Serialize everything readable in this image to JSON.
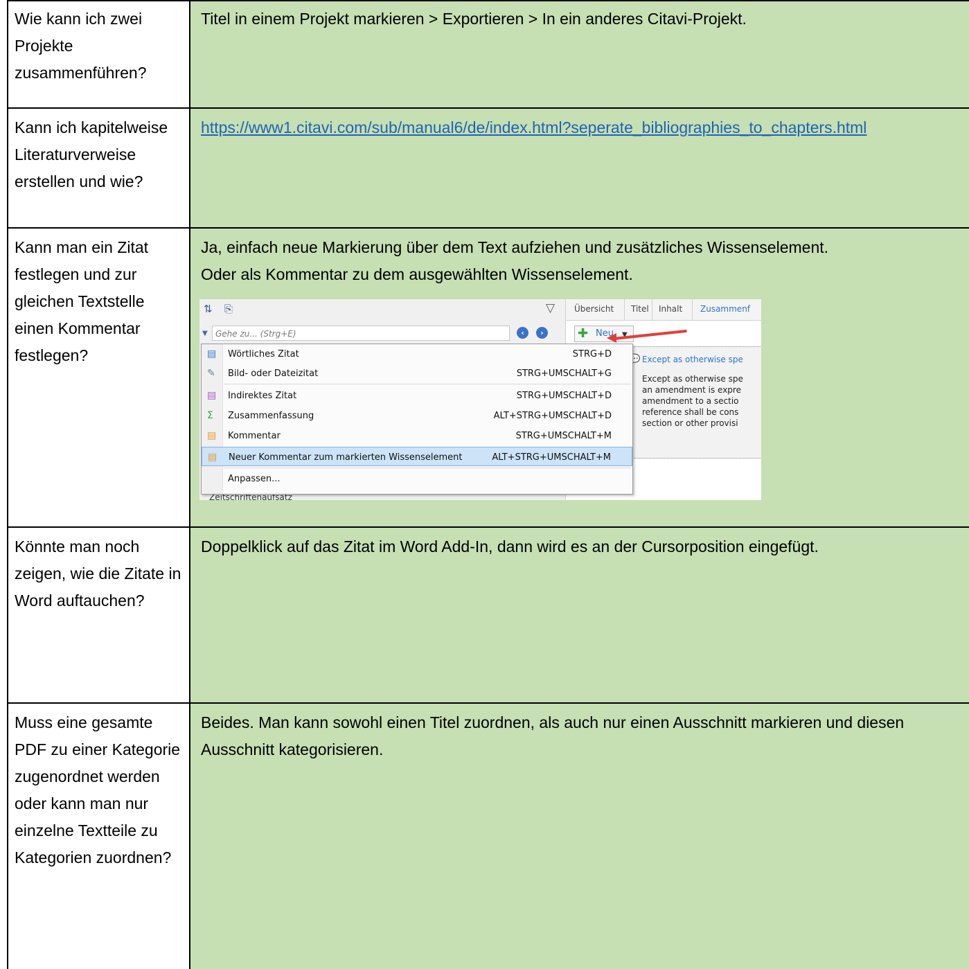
{
  "rows": [
    {
      "question": "Wie kann ich zwei Projekte zusammenführen?",
      "answer": "Titel in einem Projekt markieren > Exportieren > In ein anderes Citavi-Projekt."
    },
    {
      "question": "Kann ich kapitelweise Literaturverweise erstellen und wie?",
      "answer_link": "https://www1.citavi.com/sub/manual6/de/index.html?seperate_bibliographies_to_chapters.html"
    },
    {
      "question": "Kann man ein Zitat festlegen und zur gleichen Textstelle einen Kommentar festlegen?",
      "answer_line1": "Ja, einfach neue Markierung über dem Text aufziehen und zusätzliches Wissenselement.",
      "answer_line2": "Oder als Kommentar zu dem ausgewählten Wissenselement."
    },
    {
      "question": "Könnte man noch zeigen, wie die Zitate in Word auftauchen?",
      "answer": "Doppelklick auf das Zitat im Word Add-In, dann wird es an der Cursorposition eingefügt."
    },
    {
      "question": "Muss eine gesamte PDF zu einer Kategorie zugenordnet werden oder kann man nur einzelne Textteile zu Kategorien zuordnen?",
      "answer": "Beides. Man kann sowohl einen Titel zuordnen, als auch nur einen Ausschnitt markieren und diesen Ausschnitt kategorisieren."
    }
  ],
  "screenshot": {
    "search_placeholder": "Gehe zu... (Strg+E)",
    "tabs": [
      "Übersicht",
      "Titel",
      "Inhalt",
      "Zusammenf"
    ],
    "new_button": "Neu",
    "knowledge_title": "Except as otherwise spe",
    "knowledge_text": "Except as otherwise spe\nan amendment is expre\namendment to a sectio\nreference shall be cons\nsection or other provisi",
    "bottom_text": "Zeitschriftenaufsatz",
    "menu": [
      {
        "label": "Wörtliches Zitat",
        "shortcut": "STRG+D",
        "icon": "quote-bubble-blue-icon"
      },
      {
        "label": "Bild- oder Dateizitat",
        "shortcut": "STRG+UMSCHALT+G",
        "icon": "image-quote-icon"
      },
      {
        "label": "Indirektes Zitat",
        "shortcut": "STRG+UMSCHALT+D",
        "icon": "quote-bubble-purple-icon"
      },
      {
        "label": "Zusammenfassung",
        "shortcut": "ALT+STRG+UMSCHALT+D",
        "icon": "summary-bubble-green-icon"
      },
      {
        "label": "Kommentar",
        "shortcut": "STRG+UMSCHALT+M",
        "icon": "comment-bubble-orange-icon"
      },
      {
        "label": "Neuer Kommentar zum markierten Wissenselement",
        "shortcut": "ALT+STRG+UMSCHALT+M",
        "icon": "comment-bubble-orange-icon"
      },
      {
        "label": "Anpassen...",
        "shortcut": "",
        "icon": ""
      }
    ]
  },
  "colors": {
    "answer_bg": "#c6dfb3",
    "link": "#1f63b4",
    "highlight": "#cde3f7",
    "arrow": "#e0403a"
  }
}
